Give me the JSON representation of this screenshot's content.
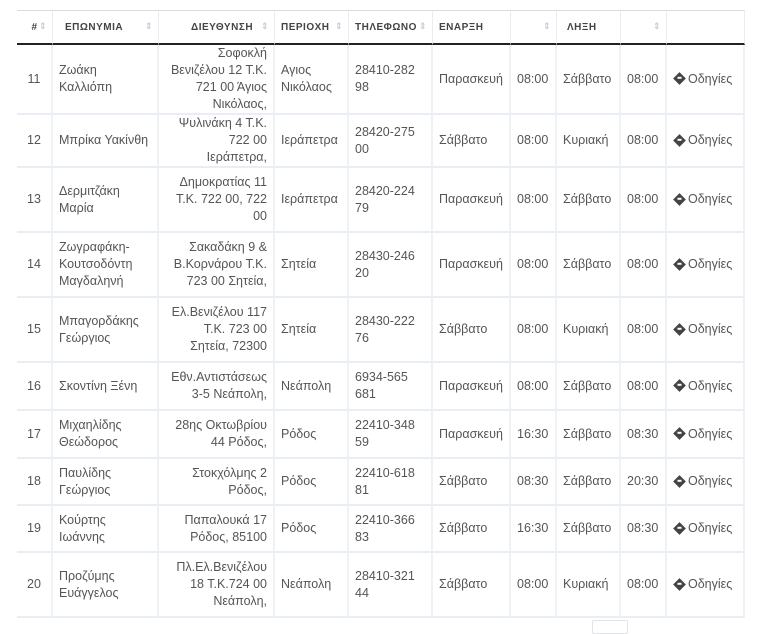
{
  "headers": {
    "num": "#",
    "name": "ΕΠΩΝΥΜΙΑ",
    "address": "ΔΙΕΥΘΥΝΣΗ",
    "area": "ΠΕΡΙΟΧΗ",
    "phone": "ΤΗΛΕΦΩΝΟ",
    "start": "ΕΝΑΡΞΗ",
    "end": "ΛΗΞΗ"
  },
  "sort_glyph": "⇕",
  "directions_icon": "directions-diamond-icon",
  "rows": [
    {
      "num": "11",
      "name": "Ζωάκη Καλλιόπη",
      "address": "Σοφοκλή Βενιζέλου 12 Τ.Κ. 721 00 Άγιος Νικόλαος,",
      "area": "Αγιος Νικόλαος",
      "phone": "28410-282 98",
      "start_day": "Παρασκευή",
      "start_time": "08:00",
      "end_day": "Σάββατο",
      "end_time": "08:00",
      "link": "Οδηγίες"
    },
    {
      "num": "12",
      "name": "Μπρίκα Υακίνθη",
      "address": "Ψυλινάκη 4 Τ.Κ. 722 00 Ιεράπετρα,",
      "area": "Ιεράπετρα",
      "phone": "28420-275 00",
      "start_day": "Σάββατο",
      "start_time": "08:00",
      "end_day": "Κυριακή",
      "end_time": "08:00",
      "link": "Οδηγίες"
    },
    {
      "num": "13",
      "name": "Δερμιτζάκη Μαρία",
      "address": "Δημοκρατίας 11 Τ.Κ. 722 00, 722 00",
      "area": "Ιεράπετρα",
      "phone": "28420-224 79",
      "start_day": "Παρασκευή",
      "start_time": "08:00",
      "end_day": "Σάββατο",
      "end_time": "08:00",
      "link": "Οδηγίες"
    },
    {
      "num": "14",
      "name": "Ζωγραφάκη-Κουτσοδόντη Μαγδαληνή",
      "address": "Σακαδάκη 9 & Β.Κορνάρου Τ.Κ. 723 00 Σητεία,",
      "area": "Σητεία",
      "phone": "28430-246 20",
      "start_day": "Παρασκευή",
      "start_time": "08:00",
      "end_day": "Σάββατο",
      "end_time": "08:00",
      "link": "Οδηγίες"
    },
    {
      "num": "15",
      "name": "Μπαγορδάκης Γεώργιος",
      "address": "Ελ.Βενιζέλου 117 Τ.Κ. 723 00 Σητεία, 72300",
      "area": "Σητεία",
      "phone": "28430-222 76",
      "start_day": "Σάββατο",
      "start_time": "08:00",
      "end_day": "Κυριακή",
      "end_time": "08:00",
      "link": "Οδηγίες"
    },
    {
      "num": "16",
      "name": "Σκοντίνη Ξένη",
      "address": "Εθν.Αντιστάσεως 3-5 Νεάπολη,",
      "area": "Νεάπολη",
      "phone": "6934-565 681",
      "start_day": "Παρασκευή",
      "start_time": "08:00",
      "end_day": "Σάββατο",
      "end_time": "08:00",
      "link": "Οδηγίες"
    },
    {
      "num": "17",
      "name": "Μιχαηλίδης Θεώδορος",
      "address": "28ης Οκτωβρίου 44 Ρόδος,",
      "area": "Ρόδος",
      "phone": "22410-348 59",
      "start_day": "Παρασκευή",
      "start_time": "16:30",
      "end_day": "Σάββατο",
      "end_time": "08:30",
      "link": "Οδηγίες"
    },
    {
      "num": "18",
      "name": "Παυλίδης Γεώργιος",
      "address": "Στοκχόλμης 2 Ρόδος,",
      "area": "Ρόδος",
      "phone": "22410-618 81",
      "start_day": "Σάββατο",
      "start_time": "08:30",
      "end_day": "Σάββατο",
      "end_time": "20:30",
      "link": "Οδηγίες"
    },
    {
      "num": "19",
      "name": "Κούρτης Ιωάννης",
      "address": "Παπαλουκά 17 Ρόδος, 85100",
      "area": "Ρόδος",
      "phone": "22410-366 83",
      "start_day": "Σάββατο",
      "start_time": "16:30",
      "end_day": "Σάββατο",
      "end_time": "08:30",
      "link": "Οδηγίες"
    },
    {
      "num": "20",
      "name": "Προζύμης Ευάγγελος",
      "address": "Πλ.Ελ.Βενιζέλου 18 Τ.Κ.724 00 Νεάπολη,",
      "area": "Νεάπολη",
      "phone": "28410-321 44",
      "start_day": "Σάββατο",
      "start_time": "08:00",
      "end_day": "Κυριακή",
      "end_time": "08:00",
      "link": "Οδηγίες"
    }
  ]
}
